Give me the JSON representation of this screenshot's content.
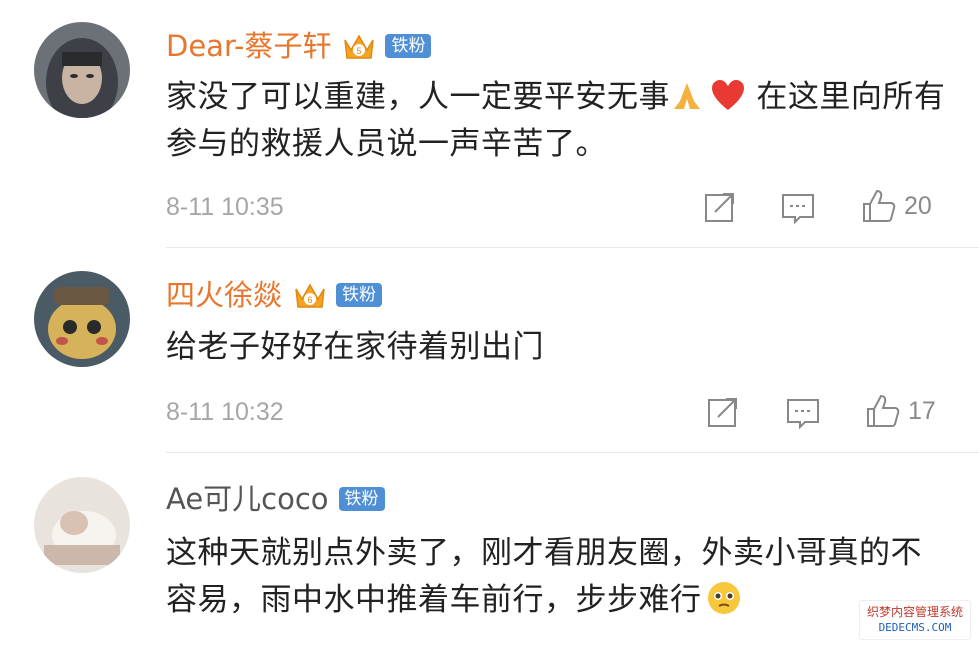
{
  "comments": [
    {
      "username": "Dear-蔡子轩",
      "username_color": "#e8772e",
      "vip": true,
      "badge": "铁粉",
      "text_before": "家没了可以重建，人一定要平安无事",
      "emojis": [
        "praying-hands",
        "red-heart"
      ],
      "text_after": " 在这里向所有参与的救援人员说一声辛苦了。",
      "time": "8-11 10:35",
      "likes": "20"
    },
    {
      "username": "四火徐燚",
      "username_color": "#e8772e",
      "vip": true,
      "badge": "铁粉",
      "text": "给老子好好在家待着别出门",
      "time": "8-11 10:32",
      "likes": "17"
    },
    {
      "username": "Ae可儿coco",
      "username_color": "#555555",
      "vip": false,
      "badge": "铁粉",
      "text_before": "这种天就别点外卖了，刚才看朋友圈，外卖小哥真的不容易，雨中水中推着车前行，步步难行",
      "emojis": [
        "pleading-face"
      ]
    }
  ],
  "watermark": {
    "line1": "织梦内容管理系统",
    "line2": "DEDECMS.COM"
  }
}
